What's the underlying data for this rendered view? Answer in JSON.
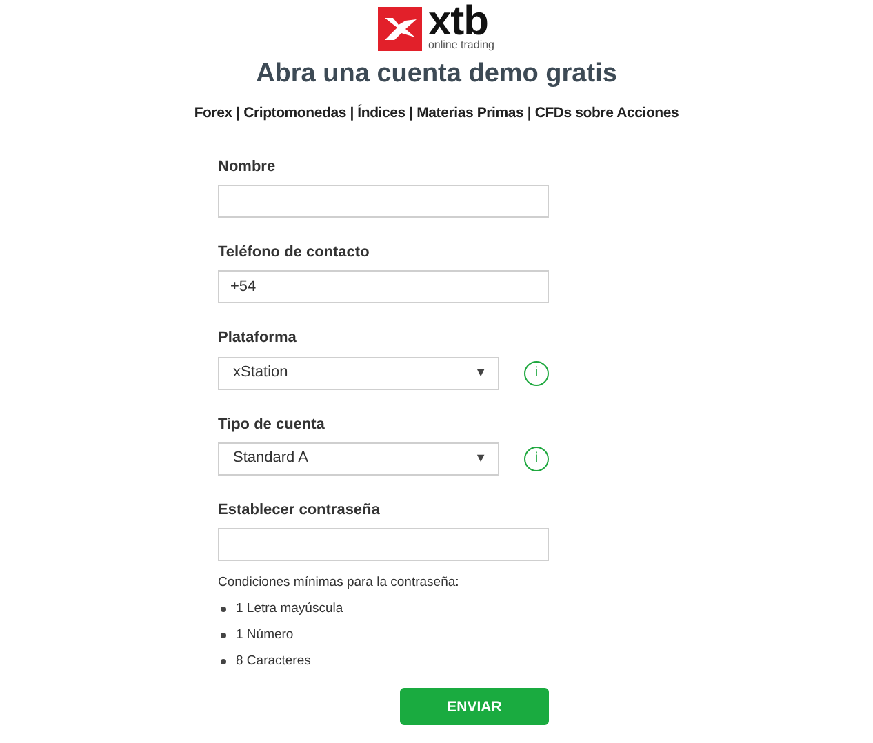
{
  "logo": {
    "name": "xtb",
    "tagline": "online trading"
  },
  "title": "Abra una cuenta demo gratis",
  "subtitle": "Forex | Criptomonedas | Índices | Materias Primas | CFDs sobre Acciones",
  "fields": [
    {
      "kind": "text",
      "label": "Nombre"
    },
    {
      "kind": "text",
      "label": "Teléfono de contacto",
      "value": "+54"
    },
    {
      "kind": "select",
      "label": "Plataforma",
      "value": "xStation",
      "caret": "▼",
      "info": "i"
    },
    {
      "kind": "select",
      "label": "Tipo de cuenta",
      "value": "Standard A",
      "caret": "▼",
      "info": "i"
    },
    {
      "kind": "password",
      "label": "Establecer contraseña"
    }
  ],
  "password_rules": {
    "heading": "Condiciones mínimas para la contraseña:",
    "items": [
      "1 Letra mayúscula",
      "1 Número",
      "8 Caracteres"
    ]
  },
  "submit": "ENVIAR"
}
